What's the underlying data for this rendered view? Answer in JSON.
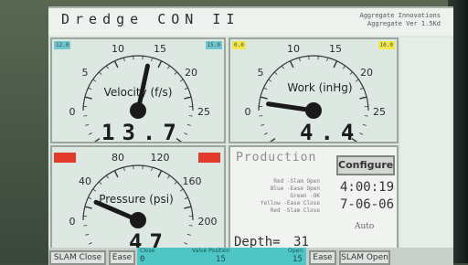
{
  "app": {
    "title": "Dredge CON II",
    "company_line1": "Aggregate Innovations",
    "company_line2": "Aggregate Ver 1.5Kd"
  },
  "velocity": {
    "title": "Velocity (f/s)",
    "readout": "13.7",
    "min_tag": "12.0",
    "max_tag": "15.0",
    "scale_labels": [
      "0",
      "5",
      "10",
      "15",
      "20",
      "25"
    ],
    "scale_min": 0,
    "scale_max": 25,
    "value": 13.7
  },
  "work": {
    "title": "Work (inHg)",
    "readout": "4.4",
    "min_tag": "0.0",
    "max_tag": "10.0",
    "scale_labels": [
      "0",
      "5",
      "10",
      "15",
      "20",
      "25"
    ],
    "scale_min": 0,
    "scale_max": 25,
    "value": 4.4
  },
  "pressure": {
    "title": "Pressure (psi)",
    "readout": "47",
    "scale_labels": [
      "0",
      "40",
      "80",
      "120",
      "160",
      "200"
    ],
    "scale_min": 0,
    "scale_max": 200,
    "value": 47
  },
  "production": {
    "title": "Production",
    "configure_label": "Configure",
    "time": "4:00:19",
    "date": "7-06-06",
    "mode": "Auto",
    "legend": [
      "Red -Slam Open",
      "Blue -Ease Open",
      "Green -OK",
      "Yellow -Ease Close",
      "Red -Slam Close"
    ],
    "depth_label": "Depth=",
    "depth_value": "31"
  },
  "bottom": {
    "slam_close": "SLAM Close",
    "ease_left": "Ease",
    "valve_title": "Valve Position",
    "valve_close": "Close",
    "valve_open": "Open",
    "valve_values": [
      "0",
      "15",
      "15"
    ],
    "ease_right": "Ease",
    "slam_open": "SLAM Open"
  },
  "colors": {
    "blue_tag": "#6fc7d0",
    "yellow_tag": "#f1e84a",
    "red_tag": "#e33a2e",
    "valve_bar": "#4fc6c6"
  }
}
